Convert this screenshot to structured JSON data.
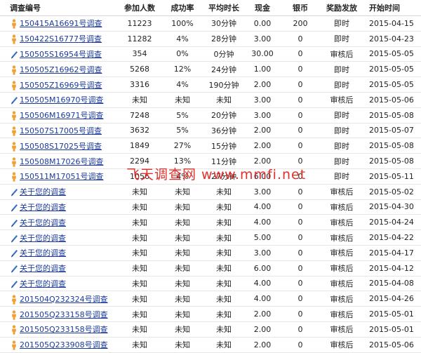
{
  "headers": [
    "调查编号",
    "参加人数",
    "成功率",
    "平均时长",
    "现金",
    "银币",
    "奖励发放",
    "开始时间"
  ],
  "rows": [
    {
      "icon": "person-icon",
      "id": "150415A16691号调查",
      "participants": "11223",
      "success": "100%",
      "avg": "30分钟",
      "cash": "0.00",
      "coins": "200",
      "reward": "即时",
      "date": "2015-04-15"
    },
    {
      "icon": "person-icon",
      "id": "150422S16777号调查",
      "participants": "11282",
      "success": "4%",
      "avg": "28分钟",
      "cash": "3.00",
      "coins": "0",
      "reward": "即时",
      "date": "2015-04-23"
    },
    {
      "icon": "pencil-icon",
      "id": "150505S16954号调查",
      "participants": "354",
      "success": "0%",
      "avg": "0分钟",
      "cash": "30.00",
      "coins": "0",
      "reward": "审核后",
      "date": "2015-05-05"
    },
    {
      "icon": "person-icon",
      "id": "150505Z16962号调查",
      "participants": "5268",
      "success": "12%",
      "avg": "24分钟",
      "cash": "1.00",
      "coins": "0",
      "reward": "即时",
      "date": "2015-05-05"
    },
    {
      "icon": "person-icon",
      "id": "150505Z16969号调查",
      "participants": "3316",
      "success": "4%",
      "avg": "190分钟",
      "cash": "2.00",
      "coins": "0",
      "reward": "即时",
      "date": "2015-05-05"
    },
    {
      "icon": "pencil-icon",
      "id": "150505M16970号调查",
      "participants": "未知",
      "success": "未知",
      "avg": "未知",
      "cash": "3.00",
      "coins": "0",
      "reward": "审核后",
      "date": "2015-05-06"
    },
    {
      "icon": "person-icon",
      "id": "150506M16971号调查",
      "participants": "7248",
      "success": "5%",
      "avg": "20分钟",
      "cash": "3.00",
      "coins": "0",
      "reward": "即时",
      "date": "2015-05-08"
    },
    {
      "icon": "person-icon",
      "id": "150507S17005号调查",
      "participants": "3632",
      "success": "5%",
      "avg": "36分钟",
      "cash": "2.00",
      "coins": "0",
      "reward": "即时",
      "date": "2015-05-07"
    },
    {
      "icon": "person-icon",
      "id": "150508S17025号调查",
      "participants": "1849",
      "success": "27%",
      "avg": "15分钟",
      "cash": "2.00",
      "coins": "0",
      "reward": "即时",
      "date": "2015-05-08"
    },
    {
      "icon": "person-icon",
      "id": "150508M17026号调查",
      "participants": "2294",
      "success": "13%",
      "avg": "11分钟",
      "cash": "2.00",
      "coins": "0",
      "reward": "即时",
      "date": "2015-05-08"
    },
    {
      "icon": "person-icon",
      "id": "150511M17051号调查",
      "participants": "1056",
      "success": "4%",
      "avg": "27分钟",
      "cash": "6.00",
      "coins": "0",
      "reward": "即时",
      "date": "2015-05-11"
    },
    {
      "icon": "pencil-icon",
      "id": "关于您的调查",
      "participants": "未知",
      "success": "未知",
      "avg": "未知",
      "cash": "3.00",
      "coins": "0",
      "reward": "审核后",
      "date": "2015-05-02"
    },
    {
      "icon": "pencil-icon",
      "id": "关于您的调查",
      "participants": "未知",
      "success": "未知",
      "avg": "未知",
      "cash": "4.00",
      "coins": "0",
      "reward": "审核后",
      "date": "2015-04-30"
    },
    {
      "icon": "pencil-icon",
      "id": "关于您的调查",
      "participants": "未知",
      "success": "未知",
      "avg": "未知",
      "cash": "4.00",
      "coins": "0",
      "reward": "审核后",
      "date": "2015-04-24"
    },
    {
      "icon": "pencil-icon",
      "id": "关于您的调查",
      "participants": "未知",
      "success": "未知",
      "avg": "未知",
      "cash": "5.00",
      "coins": "0",
      "reward": "审核后",
      "date": "2015-04-22"
    },
    {
      "icon": "pencil-icon",
      "id": "关于您的调查",
      "participants": "未知",
      "success": "未知",
      "avg": "未知",
      "cash": "3.00",
      "coins": "0",
      "reward": "审核后",
      "date": "2015-04-17"
    },
    {
      "icon": "pencil-icon",
      "id": "关于您的调查",
      "participants": "未知",
      "success": "未知",
      "avg": "未知",
      "cash": "6.00",
      "coins": "0",
      "reward": "审核后",
      "date": "2015-04-12"
    },
    {
      "icon": "pencil-icon",
      "id": "关于您的调查",
      "participants": "未知",
      "success": "未知",
      "avg": "未知",
      "cash": "4.00",
      "coins": "0",
      "reward": "审核后",
      "date": "2015-04-08"
    },
    {
      "icon": "person-icon",
      "id": "201504Q232324号调查",
      "participants": "未知",
      "success": "未知",
      "avg": "未知",
      "cash": "4.00",
      "coins": "0",
      "reward": "审核后",
      "date": "2015-04-26"
    },
    {
      "icon": "person-icon",
      "id": "201505Q233158号调查",
      "participants": "未知",
      "success": "未知",
      "avg": "未知",
      "cash": "2.00",
      "coins": "0",
      "reward": "审核后",
      "date": "2015-05-01"
    },
    {
      "icon": "person-icon",
      "id": "201505Q233158号调查",
      "participants": "未知",
      "success": "未知",
      "avg": "未知",
      "cash": "2.00",
      "coins": "0",
      "reward": "审核后",
      "date": "2015-05-01"
    },
    {
      "icon": "person-icon",
      "id": "201505Q233908号调查",
      "participants": "未知",
      "success": "未知",
      "avg": "未知",
      "cash": "2.00",
      "coins": "0",
      "reward": "审核后",
      "date": "2015-05-06"
    }
  ],
  "watermark": "飞天调查网 www.mmfi.net",
  "colors": {
    "link": "#1a3a9e",
    "person_icon": "#f0a030",
    "pencil_icon": "#3a6fc4",
    "watermark": "#e0302a"
  }
}
